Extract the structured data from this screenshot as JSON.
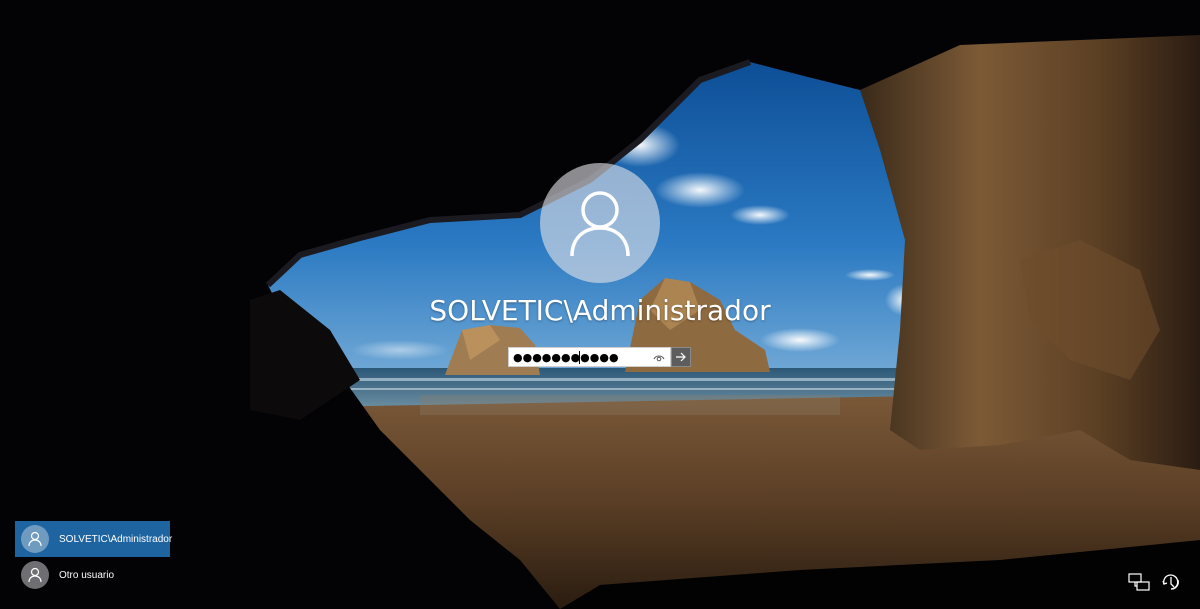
{
  "login": {
    "username": "SOLVETIC\\Administrador",
    "password_masked": "●●●●●●●●●●●",
    "reveal_icon": "eye-icon",
    "submit_icon": "arrow-right-icon"
  },
  "users": [
    {
      "label": "SOLVETIC\\Administrador",
      "selected": true
    },
    {
      "label": "Otro usuario",
      "selected": false
    }
  ],
  "tray": {
    "network_icon": "network-icon",
    "accessibility_icon": "ease-of-access-icon"
  }
}
